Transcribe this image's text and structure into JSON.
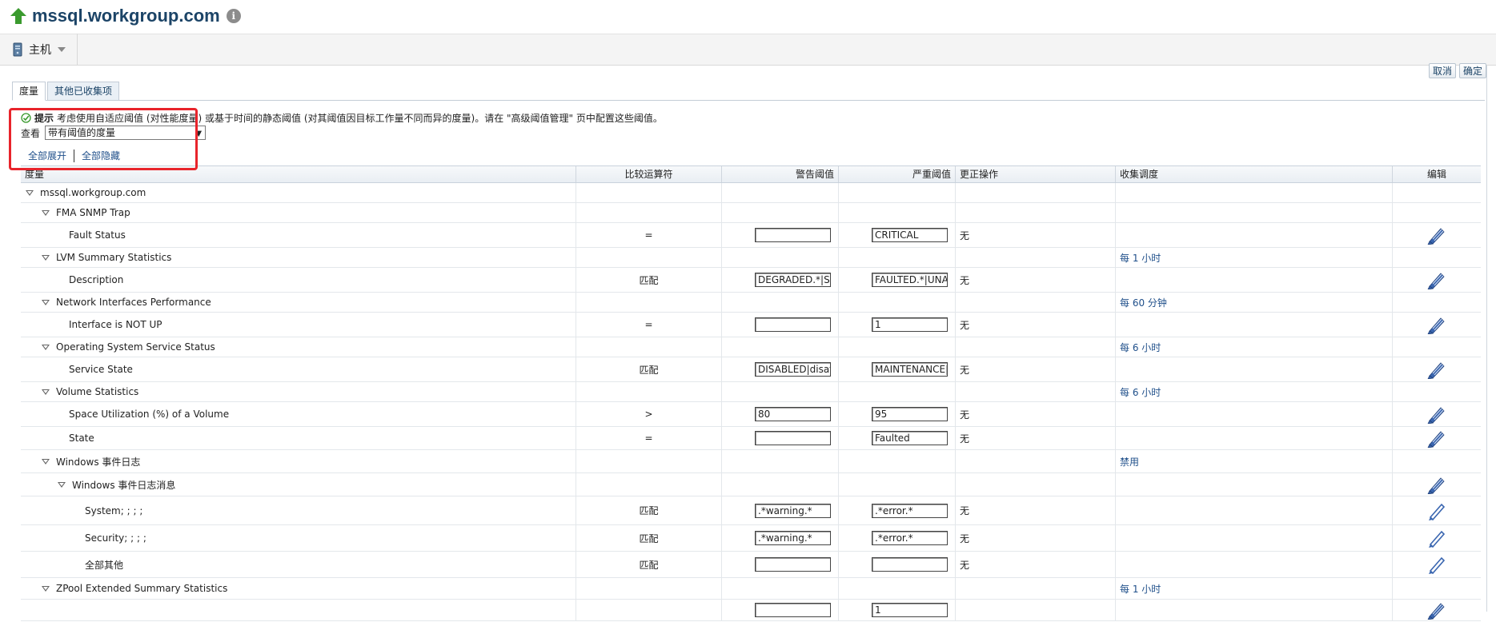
{
  "app": {
    "title": "mssql.workgroup.com"
  },
  "menu": {
    "host_label": "主机"
  },
  "buttons": {
    "cancel": "取消",
    "ok": "确定"
  },
  "tabs": [
    {
      "label": "度量"
    },
    {
      "label": "其他已收集项"
    }
  ],
  "hint": {
    "label": "提示",
    "text": "考虑使用自适应阈值 (对性能度量) 或基于时间的静态阈值 (对其阈值因目标工作量不同而异的度量)。请在 \"高级阈值管理\" 页中配置这些阈值。"
  },
  "view": {
    "label": "查看",
    "selected": "带有阈值的度量"
  },
  "expand": {
    "expand_all": "全部展开",
    "collapse_all": "全部隐藏"
  },
  "columns": {
    "metric": "度量",
    "operator": "比较运算符",
    "warning": "警告阈值",
    "critical": "严重阈值",
    "action": "更正操作",
    "schedule": "收集调度",
    "edit": "编辑"
  },
  "rows": [
    {
      "metric": "mssql.workgroup.com",
      "operator": "",
      "warning": "",
      "critical": "",
      "action": "",
      "schedule": ""
    },
    {
      "metric": "FMA SNMP Trap",
      "operator": "",
      "warning": "",
      "critical": "",
      "action": "",
      "schedule": ""
    },
    {
      "metric": "Fault Status",
      "operator": "=",
      "warning": "",
      "critical": "CRITICAL",
      "action": "无",
      "schedule": ""
    },
    {
      "metric": "LVM Summary Statistics",
      "operator": "",
      "warning": "",
      "critical": "",
      "action": "",
      "schedule": "每 1 小时"
    },
    {
      "metric": "Description",
      "operator": "匹配",
      "warning": "DEGRADED.*|SU",
      "critical": "FAULTED.*|UNA",
      "action": "无",
      "schedule": ""
    },
    {
      "metric": "Network Interfaces Performance",
      "operator": "",
      "warning": "",
      "critical": "",
      "action": "",
      "schedule": "每 60 分钟"
    },
    {
      "metric": "Interface is NOT UP",
      "operator": "=",
      "warning": "",
      "critical": "1",
      "action": "无",
      "schedule": ""
    },
    {
      "metric": "Operating System Service Status",
      "operator": "",
      "warning": "",
      "critical": "",
      "action": "",
      "schedule": "每 6 小时"
    },
    {
      "metric": "Service State",
      "operator": "匹配",
      "warning": "DISABLED|disat",
      "critical": "MAINTENANCE|",
      "action": "无",
      "schedule": ""
    },
    {
      "metric": "Volume Statistics",
      "operator": "",
      "warning": "",
      "critical": "",
      "action": "",
      "schedule": "每 6 小时"
    },
    {
      "metric": "Space Utilization (%) of a Volume",
      "operator": ">",
      "warning": "80",
      "critical": "95",
      "action": "无",
      "schedule": ""
    },
    {
      "metric": "State",
      "operator": "=",
      "warning": "",
      "critical": "Faulted",
      "action": "无",
      "schedule": ""
    },
    {
      "metric": "Windows 事件日志",
      "operator": "",
      "warning": "",
      "critical": "",
      "action": "",
      "schedule": "禁用"
    },
    {
      "metric": "Windows 事件日志消息",
      "operator": "",
      "warning": "",
      "critical": "",
      "action": "",
      "schedule": ""
    },
    {
      "metric": "System; ; ; ;",
      "operator": "匹配",
      "warning": ".*warning.*",
      "critical": ".*error.*",
      "action": "无",
      "schedule": ""
    },
    {
      "metric": "Security; ; ; ;",
      "operator": "匹配",
      "warning": ".*warning.*",
      "critical": ".*error.*",
      "action": "无",
      "schedule": ""
    },
    {
      "metric": "全部其他",
      "operator": "匹配",
      "warning": "",
      "critical": "",
      "action": "无",
      "schedule": ""
    },
    {
      "metric": "ZPool Extended Summary Statistics",
      "operator": "",
      "warning": "",
      "critical": "",
      "action": "",
      "schedule": "每 1 小时"
    },
    {
      "metric": "",
      "operator": "",
      "warning": "",
      "critical": "1",
      "action": "",
      "schedule": ""
    }
  ]
}
